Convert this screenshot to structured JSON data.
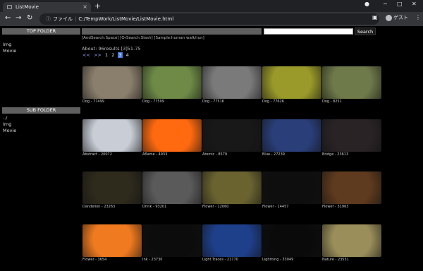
{
  "browser": {
    "tab_title": "ListMovie",
    "tab_close": "×",
    "new_tab": "+",
    "url_prefix": "ファイル",
    "url": "C:/TempWork/ListMovie/ListMovie.html",
    "guest_label": "ゲスト",
    "window_min": "−",
    "window_max": "□",
    "window_close": "✕"
  },
  "sidebar": {
    "top_folder_title": "TOP FOLDER",
    "top_folder_items": [
      "Img",
      "Movie"
    ],
    "sub_folder_title": "SUB FOLDER",
    "sub_folder_items": [
      "../",
      "Img",
      "Movie"
    ]
  },
  "search": {
    "keyword_value": "",
    "query_value": "",
    "button_label": "Search",
    "hint": "[AndSearch:Space] [OrSearch:Slash] [Sample:human walk/run]"
  },
  "results": {
    "about": "About: 96results [3]51-75",
    "pager": [
      "<<",
      ">>",
      "1",
      "2",
      "3",
      "4"
    ],
    "current_page": "3"
  },
  "thumbnails": [
    {
      "caption": "Dog - 77499",
      "color": "#8a7f6c"
    },
    {
      "caption": "Dog - 77509",
      "color": "#6e8a46"
    },
    {
      "caption": "Dog - 77516",
      "color": "#7a7a7a"
    },
    {
      "caption": "Dog - 77626",
      "color": "#9a9a2a"
    },
    {
      "caption": "Dog - 8251",
      "color": "#6f7a4a"
    },
    {
      "caption": "Abstract - 20072",
      "color": "#c8cdd6"
    },
    {
      "caption": "Aflame - 4933",
      "color": "#ff6a10"
    },
    {
      "caption": "Atomic - 8579",
      "color": "#181818"
    },
    {
      "caption": "Blue - 27239",
      "color": "#2a3f7a"
    },
    {
      "caption": "Bridge - 23613",
      "color": "#2a2326"
    },
    {
      "caption": "Dandelion - 23263",
      "color": "#2e2a1c"
    },
    {
      "caption": "Drink - 93201",
      "color": "#5a5a5a"
    },
    {
      "caption": "Flower - 12060",
      "color": "#6a6330"
    },
    {
      "caption": "Flower - 14457",
      "color": "#0e0e0e"
    },
    {
      "caption": "Flower - 31963",
      "color": "#5e3a1e"
    },
    {
      "caption": "Flower - 3654",
      "color": "#f07a20"
    },
    {
      "caption": "Ink - 23730",
      "color": "#0c0c0c"
    },
    {
      "caption": "Light Traces - 21770",
      "color": "#1e3f8a"
    },
    {
      "caption": "Lightning - 33049",
      "color": "#0a0a0a"
    },
    {
      "caption": "Nature - 23551",
      "color": "#9a8e5a"
    }
  ]
}
